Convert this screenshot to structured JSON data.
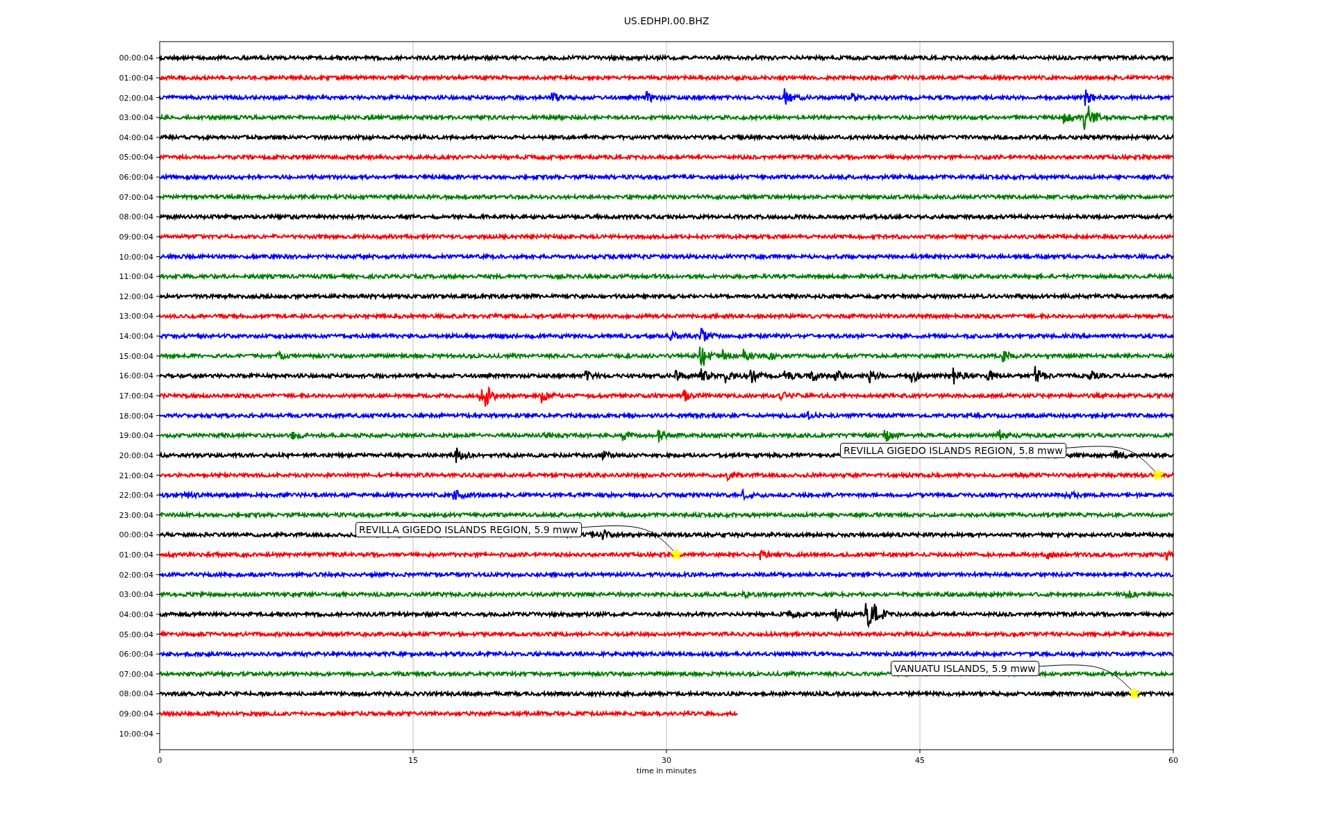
{
  "title": "US.EDHPI.00.BHZ",
  "xlabel": "time in minutes",
  "xticks": [
    "0",
    "15",
    "30",
    "45",
    "60"
  ],
  "traces": [
    {
      "label": "00:00:04",
      "color": "#000000",
      "level": 1
    },
    {
      "label": "01:00:04",
      "color": "#ff0000",
      "level": 1
    },
    {
      "label": "02:00:04",
      "color": "#0000ff",
      "level": 1
    },
    {
      "label": "03:00:04",
      "color": "#008000",
      "level": 1
    },
    {
      "label": "04:00:04",
      "color": "#000000",
      "level": 1
    },
    {
      "label": "05:00:04",
      "color": "#ff0000",
      "level": 1
    },
    {
      "label": "06:00:04",
      "color": "#0000ff",
      "level": 1
    },
    {
      "label": "07:00:04",
      "color": "#008000",
      "level": 1
    },
    {
      "label": "08:00:04",
      "color": "#000000",
      "level": 1
    },
    {
      "label": "09:00:04",
      "color": "#ff0000",
      "level": 1
    },
    {
      "label": "10:00:04",
      "color": "#0000ff",
      "level": 1
    },
    {
      "label": "11:00:04",
      "color": "#008000",
      "level": 1
    },
    {
      "label": "12:00:04",
      "color": "#000000",
      "level": 1
    },
    {
      "label": "13:00:04",
      "color": "#ff0000",
      "level": 1
    },
    {
      "label": "14:00:04",
      "color": "#0000ff",
      "level": 1
    },
    {
      "label": "15:00:04",
      "color": "#008000",
      "level": 1
    },
    {
      "label": "16:00:04",
      "color": "#000000",
      "level": 1
    },
    {
      "label": "17:00:04",
      "color": "#ff0000",
      "level": 1
    },
    {
      "label": "18:00:04",
      "color": "#0000ff",
      "level": 1
    },
    {
      "label": "19:00:04",
      "color": "#008000",
      "level": 1
    },
    {
      "label": "20:00:04",
      "color": "#000000",
      "level": 1
    },
    {
      "label": "21:00:04",
      "color": "#ff0000",
      "level": 1,
      "event": "REVILLA GIGEDO ISLANDS REGION, 5.8 mww"
    },
    {
      "label": "22:00:04",
      "color": "#0000ff",
      "level": 1
    },
    {
      "label": "23:00:04",
      "color": "#008000",
      "level": 1
    },
    {
      "label": "00:00:04",
      "color": "#000000",
      "level": 1
    },
    {
      "label": "01:00:04",
      "color": "#ff0000",
      "level": 1,
      "event": "REVILLA GIGEDO ISLANDS REGION, 5.9 mww"
    },
    {
      "label": "02:00:04",
      "color": "#0000ff",
      "level": 1
    },
    {
      "label": "03:00:04",
      "color": "#008000",
      "level": 1
    },
    {
      "label": "04:00:04",
      "color": "#000000",
      "level": 1
    },
    {
      "label": "05:00:04",
      "color": "#ff0000",
      "level": 1
    },
    {
      "label": "06:00:04",
      "color": "#0000ff",
      "level": 1
    },
    {
      "label": "07:00:04",
      "color": "#008000",
      "level": 1
    },
    {
      "label": "08:00:04",
      "color": "#000000",
      "level": 1,
      "event": "VANUATU ISLANDS, 5.9 mww"
    },
    {
      "label": "09:00:04",
      "color": "#ff0000",
      "level": 0.57
    },
    {
      "label": "10:00:04"
    }
  ]
}
